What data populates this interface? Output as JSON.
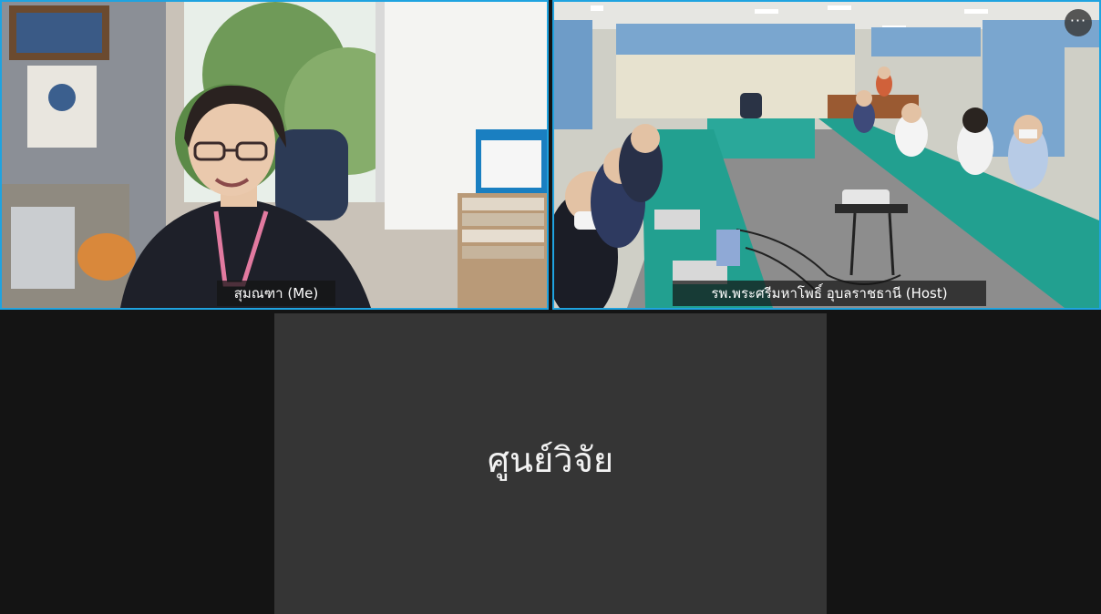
{
  "participants": {
    "me": {
      "name": "สุมณฑา",
      "suffix": "(Me)",
      "label": "สุมณฑา  (Me)"
    },
    "host": {
      "name": "รพ.พระศรีมหาโพธิ์ อุบลราชธานี",
      "suffix": "(Host)",
      "label": "รพ.พระศรีมหาโพธิ์ อุบลราชธานี  (Host)"
    },
    "center": {
      "name": "ศูนย์วิจัย"
    }
  },
  "controls": {
    "more_label": "···"
  },
  "colors": {
    "active_border": "#1fa3e0",
    "background": "#141414",
    "avatar_tile": "#353535"
  }
}
